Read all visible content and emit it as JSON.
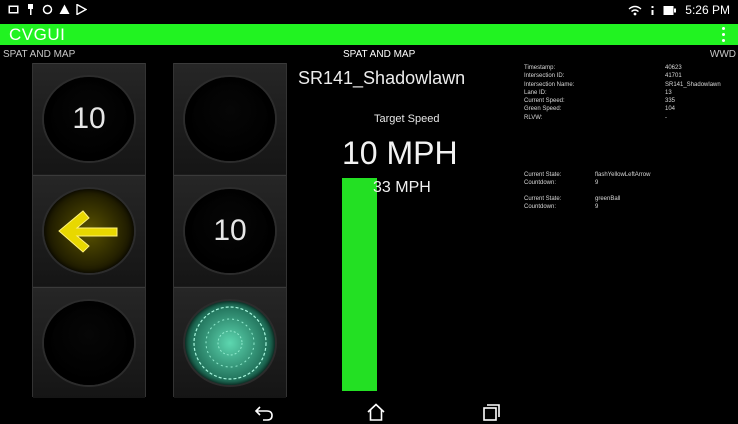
{
  "status_bar": {
    "time": "5:26 PM",
    "left_icons": [
      "image-icon",
      "usb-icon",
      "sync-icon",
      "warning-icon",
      "play-store-icon"
    ],
    "right_icons": [
      "wifi-icon",
      "signal-icon",
      "battery-icon"
    ]
  },
  "app_bar": {
    "title": "CVGUI",
    "color": "#21f321"
  },
  "tabs": {
    "left": "SPAT AND MAP",
    "center": "SPAT AND MAP",
    "right": "WWD"
  },
  "signal_heads": [
    {
      "top": "10",
      "middle": "",
      "bottom": "",
      "active": "yellow-left-arrow"
    },
    {
      "top": "",
      "middle": "10",
      "bottom": "",
      "active": "green-ball"
    }
  ],
  "intersection_name": "SR141_Shadowlawn",
  "target_speed": {
    "label": "Target Speed",
    "value": "10 MPH"
  },
  "current_speed": {
    "value": "33 MPH",
    "bar_color": "#23e023"
  },
  "info": {
    "labels": [
      "Timestamp:",
      "Intersection ID:",
      "Intersection Name:",
      "Lane ID:",
      "Current Speed:",
      "Green Speed:",
      "RLVW:"
    ],
    "values": [
      "40623",
      "41701",
      "SR141_Shadowlawn",
      "13",
      "335",
      "104",
      "-"
    ]
  },
  "states": [
    {
      "state_label": "Current State:",
      "state_value": "flashYellowLeftArrow",
      "countdown_label": "Countdown:",
      "countdown_value": "9"
    },
    {
      "state_label": "Current State:",
      "state_value": "greenBall",
      "countdown_label": "Countdown:",
      "countdown_value": "9"
    }
  ],
  "nav_bar": [
    "back-icon",
    "home-icon",
    "recent-apps-icon"
  ]
}
